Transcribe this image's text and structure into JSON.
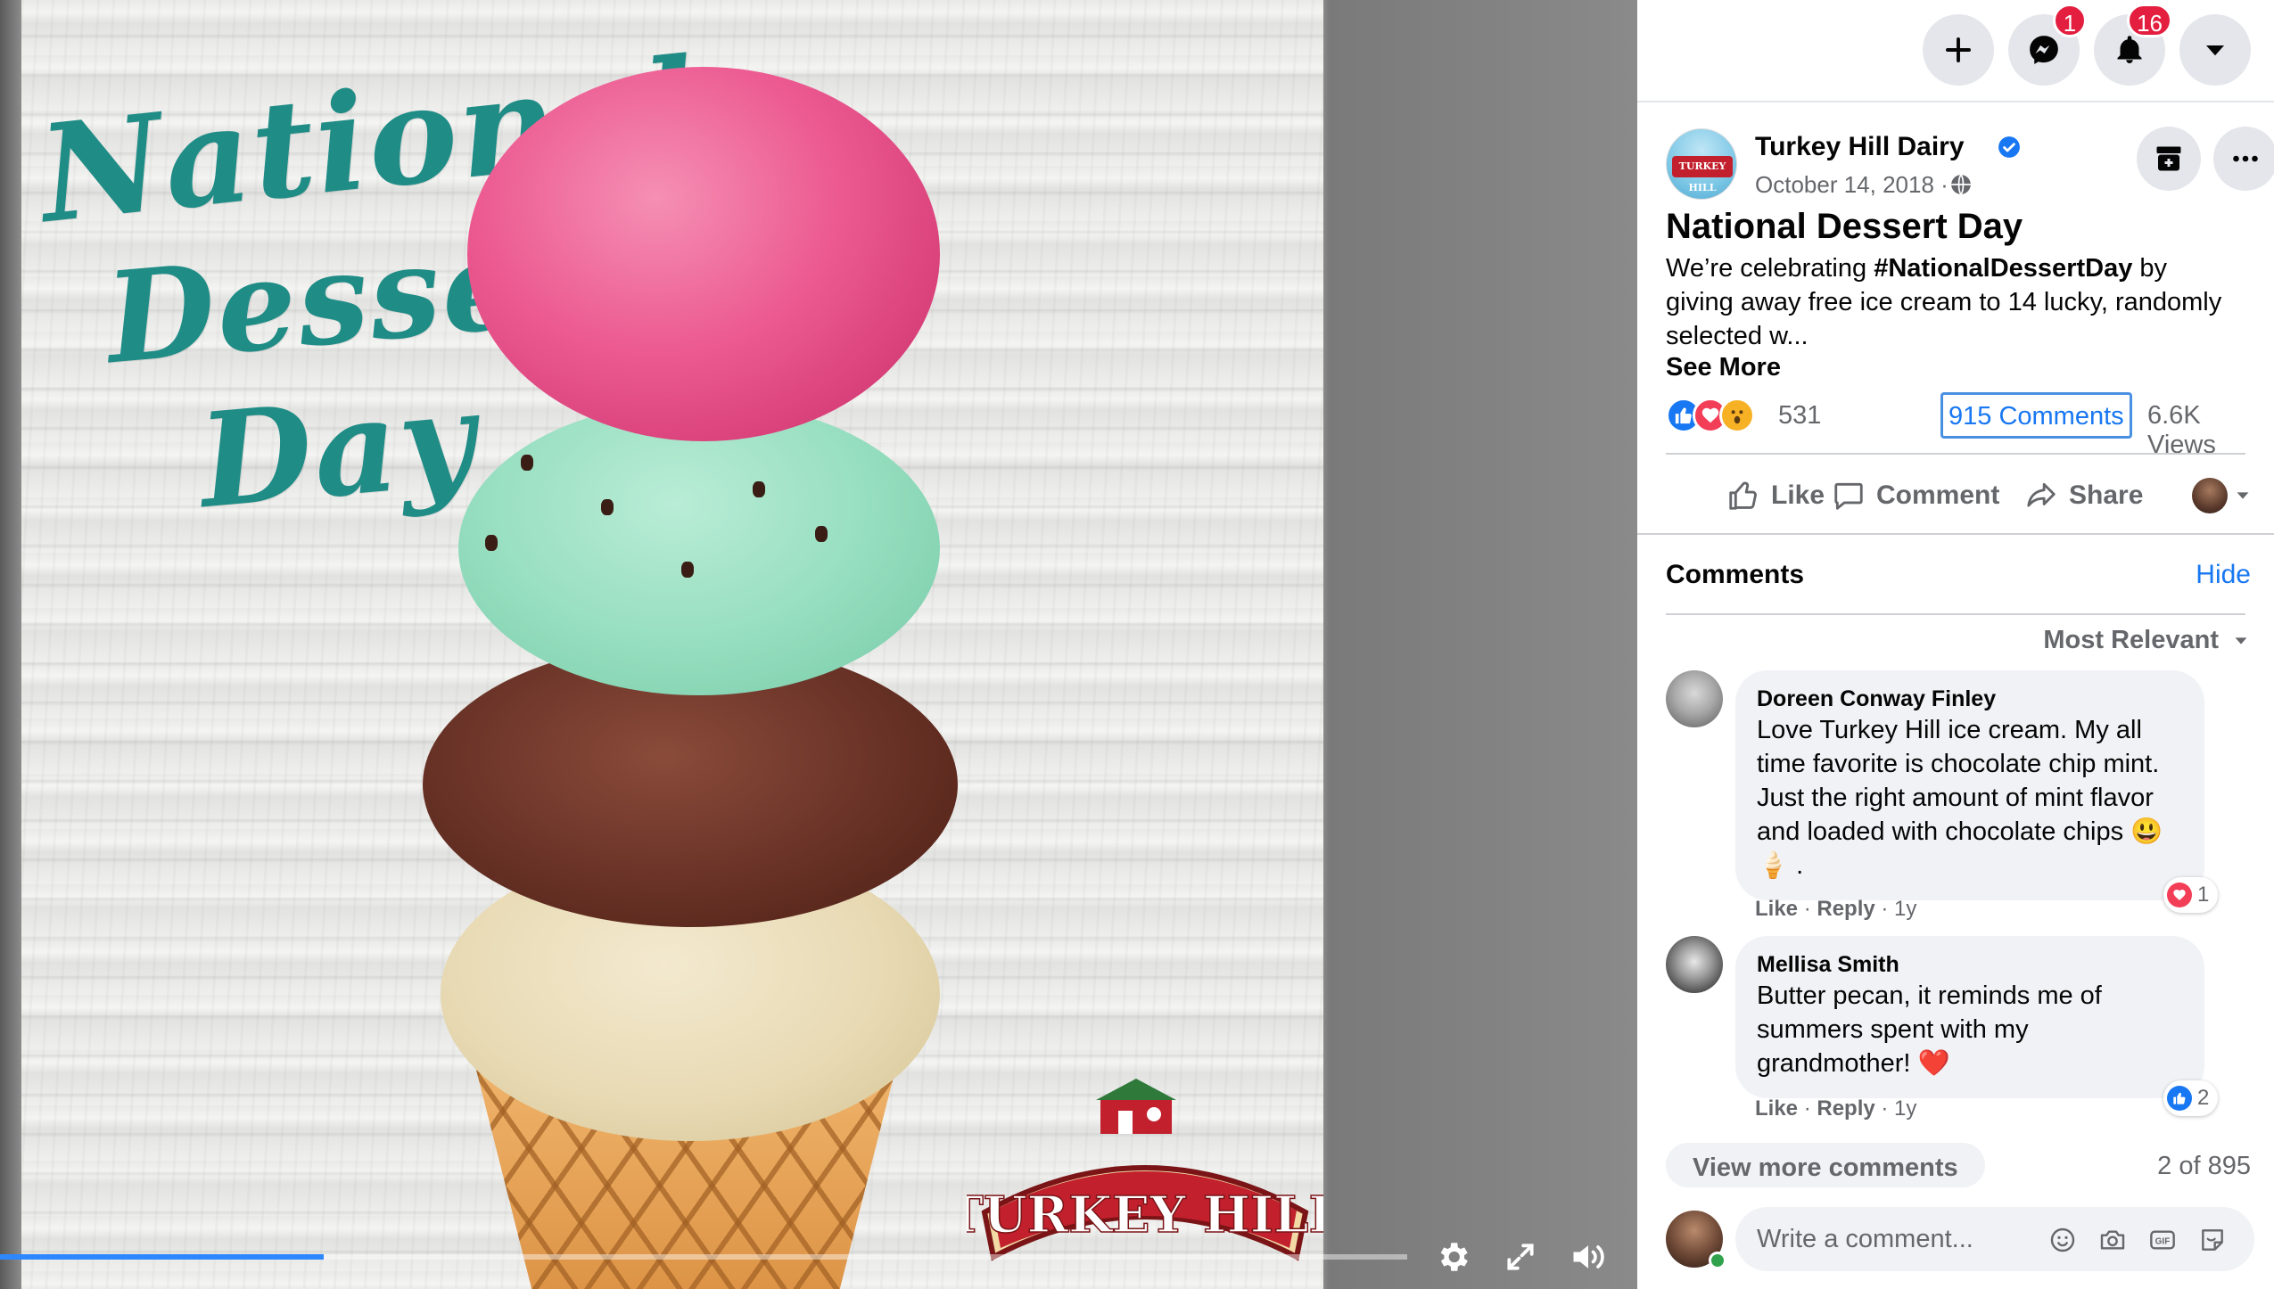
{
  "video": {
    "headline_line1": "National",
    "headline_line2": "Dessert",
    "headline_line3": "Day",
    "brand_logo_text": "TURKEY HILL",
    "progress_fraction": 0.23
  },
  "topbar": {
    "messenger_badge": "1",
    "notifications_badge": "16"
  },
  "post": {
    "page_name": "Turkey Hill Dairy",
    "date": "October 14, 2018 ·",
    "title": "National Dessert Day",
    "body_prefix": "We’re celebrating ",
    "body_hashtag": "#NationalDessertDay",
    "body_suffix": " by giving away free ice cream to 14 lucky, randomly selected w...",
    "see_more": "See More",
    "reaction_count": "531",
    "comments_count": "915 Comments",
    "views_count": "6.6K Views"
  },
  "actions": {
    "like": "Like",
    "comment": "Comment",
    "share": "Share"
  },
  "comments_section": {
    "label": "Comments",
    "hide": "Hide",
    "sort": "Most Relevant",
    "items": [
      {
        "author": "Doreen Conway Finley",
        "text": "Love Turkey Hill ice cream. My all time favorite is chocolate chip mint. Just the right amount of mint flavor and loaded with chocolate chips 😃 🍦 .",
        "like": "Like",
        "reply": "Reply",
        "age": "1y",
        "reaction_count": "1"
      },
      {
        "author": "Mellisa Smith",
        "text": "Butter pecan, it reminds me of summers spent with my grandmother! ❤️",
        "like": "Like",
        "reply": "Reply",
        "age": "1y",
        "reaction_count": "2"
      }
    ],
    "view_more": "View more comments",
    "pager": "2 of 895"
  },
  "composer": {
    "placeholder": "Write a comment..."
  },
  "colors": {
    "accent_blue": "#1877f2",
    "badge_red": "#e41e3f",
    "headline_teal": "#1f8c86"
  }
}
